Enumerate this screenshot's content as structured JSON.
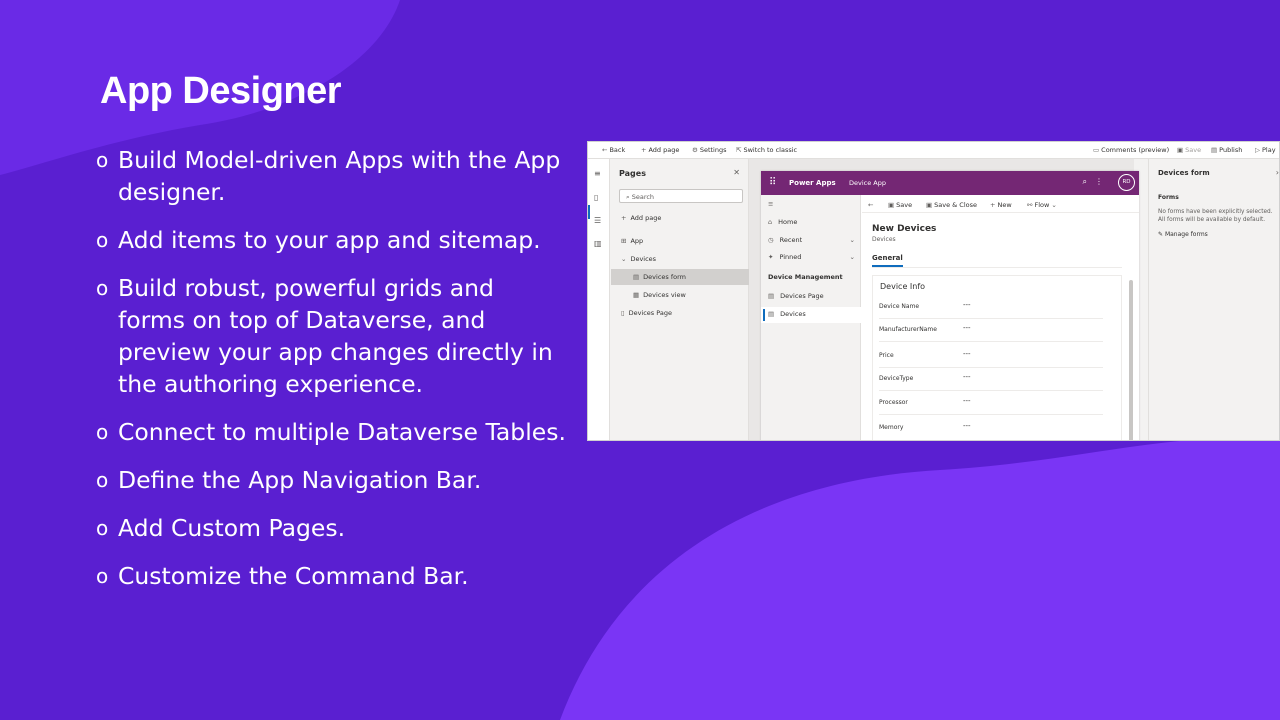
{
  "slide": {
    "title": "App Designer",
    "bullet_glyph": "o",
    "bullets": [
      "Build Model-driven Apps with the App designer.",
      "Add items to your app and sitemap.",
      "Build robust, powerful grids and forms on top of Dataverse, and preview your app changes directly in the authoring experience.",
      "Connect to multiple Dataverse Tables.",
      "Define the App Navigation Bar.",
      "Add Custom Pages.",
      "Customize the Command Bar."
    ]
  },
  "designer": {
    "command_bar": {
      "back": "Back",
      "add_page": "Add page",
      "settings": "Settings",
      "switch_classic": "Switch to classic",
      "comments": "Comments (preview)",
      "save": "Save",
      "publish": "Publish",
      "play": "Play"
    },
    "pages_panel": {
      "title": "Pages",
      "search_placeholder": "Search",
      "add_page": "Add page",
      "items": {
        "app": "App",
        "devices": "Devices",
        "devices_form": "Devices form",
        "devices_view": "Devices view",
        "devices_page": "Devices Page"
      }
    },
    "app_preview": {
      "brand": "Power Apps",
      "app_name": "Device App",
      "avatar": "RD",
      "sitemap": {
        "home": "Home",
        "recent": "Recent",
        "pinned": "Pinned",
        "group": "Device Management",
        "devices_page": "Devices Page",
        "devices": "Devices"
      },
      "form_toolbar": {
        "save": "Save",
        "save_close": "Save & Close",
        "new": "New",
        "flow": "Flow"
      },
      "form": {
        "title": "New Devices",
        "subtitle": "Devices",
        "tab": "General",
        "section": "Device Info",
        "empty_value": "---",
        "fields": [
          "Device Name",
          "ManufacturerName",
          "Price",
          "DeviceType",
          "Processor",
          "Memory"
        ]
      }
    },
    "properties": {
      "title": "Devices form",
      "forms_label": "Forms",
      "text": "No forms have been explicitly selected. All forms will be available by default.",
      "manage": "Manage forms"
    }
  },
  "colors": {
    "background": "#5a1fd1",
    "blob_light": "#6a2ae6",
    "blob_bright": "#7a35f5",
    "app_header": "#742774",
    "accent": "#0f6cbd"
  }
}
